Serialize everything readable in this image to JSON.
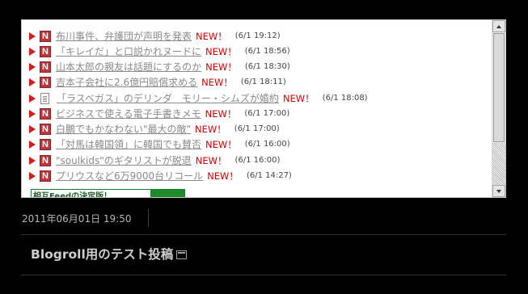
{
  "feed": {
    "items": [
      {
        "icon": "n-icon",
        "title": "布川事件、弁護団が声明を発表",
        "badge": "NEW！",
        "time": "(6/1 19:12)"
      },
      {
        "icon": "n-icon",
        "title": "「キレイだ」と口説かれヌードに",
        "badge": "NEW！",
        "time": "(6/1 18:56)"
      },
      {
        "icon": "n-icon",
        "title": "山本太郎の親友は話題にするのか",
        "badge": "NEW！",
        "time": "(6/1 18:30)"
      },
      {
        "icon": "n-icon",
        "title": "吉本子会社に2.6億円賠償求める",
        "badge": "NEW！",
        "time": "(6/1 18:11)"
      },
      {
        "icon": "document-icon",
        "title": "「ラスベガス」のデリンダ　モリー・シムズが婚約",
        "badge": "NEW！",
        "time": "(6/1 18:08)"
      },
      {
        "icon": "n-icon",
        "title": "ビジネスで使える電子手書きメモ",
        "badge": "NEW！",
        "time": "(6/1 17:00)"
      },
      {
        "icon": "n-icon",
        "title": "白鵬でもかなわない\"最大の敵\"",
        "badge": "NEW！",
        "time": "(6/1 17:00)"
      },
      {
        "icon": "n-icon",
        "title": "「対馬は韓国領」に韓国でも賛否",
        "badge": "NEW！",
        "time": "(6/1 16:00)"
      },
      {
        "icon": "n-icon",
        "title": "\"soulkids\"のギタリストが脱退",
        "badge": "NEW！",
        "time": "(6/1 16:00)"
      },
      {
        "icon": "n-icon",
        "title": "プリウスなど6万9000台リコール",
        "badge": "NEW！",
        "time": "(6/1 14:27)"
      }
    ],
    "n_icon_letter": "N",
    "banner_text": "相互Feedの決定版！"
  },
  "post": {
    "datetime": "2011年06月01日 19:50",
    "title": "Blogroll用のテスト投稿",
    "title_icon": "new-window-icon"
  },
  "colors": {
    "background": "#000000",
    "arrow": "#d41c1c",
    "n_icon": "#b9363b",
    "new_badge": "#d40000",
    "link": "#8a8a8a"
  }
}
